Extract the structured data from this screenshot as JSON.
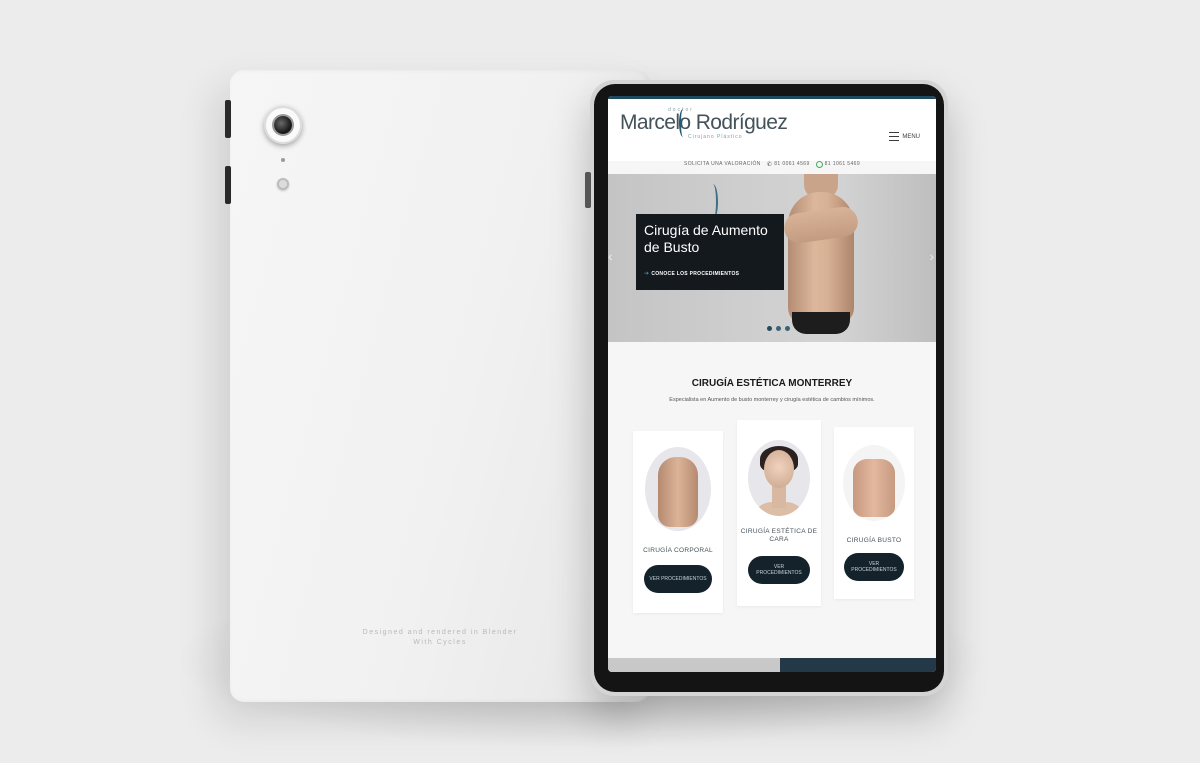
{
  "back_tablet": {
    "engraving_line1": "Designed and rendered in Blender",
    "engraving_line2": "With Cycles"
  },
  "header": {
    "logo_top": "doctor",
    "logo_main": "Marcelo Rodríguez",
    "logo_bottom": "Cirujano Plástico",
    "menu_label": "MENU"
  },
  "contact": {
    "valuation_label": "SOLICITA UNA VALORACIÓN",
    "phone1": "81 0061 4569",
    "phone2": "81 1061 5469"
  },
  "hero": {
    "title": "Cirugía de Aumento de Busto",
    "cta": "CONOCE LOS PROCEDIMIENTOS",
    "slide_count": 3,
    "active_slide": 0
  },
  "section": {
    "title": "CIRUGÍA ESTÉTICA MONTERREY",
    "subtitle": "Especialista en Aumento de busto monterrey y cirugía estética de cambios mínimos."
  },
  "cards": [
    {
      "label": "CIRUGÍA CORPORAL",
      "button": "VER PROCEDIMIENTOS"
    },
    {
      "label": "CIRUGÍA ESTÉTICA DE CARA",
      "button": "VER PROCEDIMIENTOS"
    },
    {
      "label": "CIRUGÍA BUSTO",
      "button": "VER PROCEDIMIENTOS"
    }
  ],
  "colors": {
    "brand_dark": "#13222b",
    "brand_accent": "#1f5a76",
    "whatsapp": "#3fae5a"
  }
}
